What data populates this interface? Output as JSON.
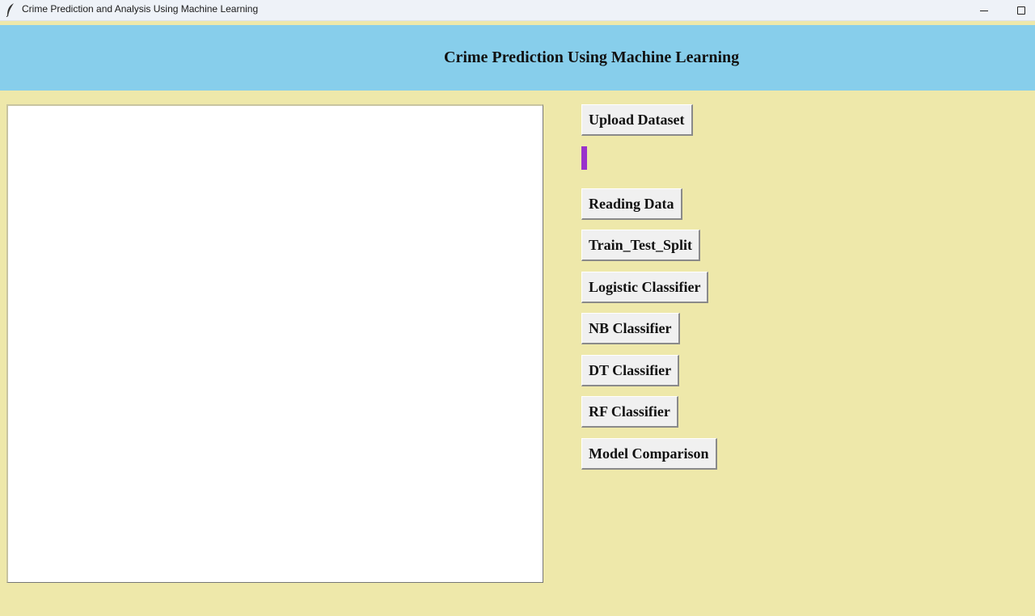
{
  "window": {
    "title": "Crime Prediction and Analysis Using Machine Learning",
    "icon": "feather-icon",
    "controls": [
      "minimize-icon",
      "maximize-icon"
    ]
  },
  "header": {
    "title": "Crime Prediction Using Machine Learning",
    "background": "#87ceeb"
  },
  "output": {
    "text": ""
  },
  "buttons": {
    "upload": "Upload Dataset",
    "reading": "Reading Data",
    "split": "Train_Test_Split",
    "logistic": "Logistic Classifier",
    "nb": "NB Classifier",
    "dt": "DT Classifier",
    "rf": "RF Classifier",
    "comparison": "Model Comparison"
  },
  "colors": {
    "background": "#eee8aa",
    "header": "#87ceeb",
    "progress_accent": "#9932cc",
    "button_face": "#f0f0f0"
  }
}
